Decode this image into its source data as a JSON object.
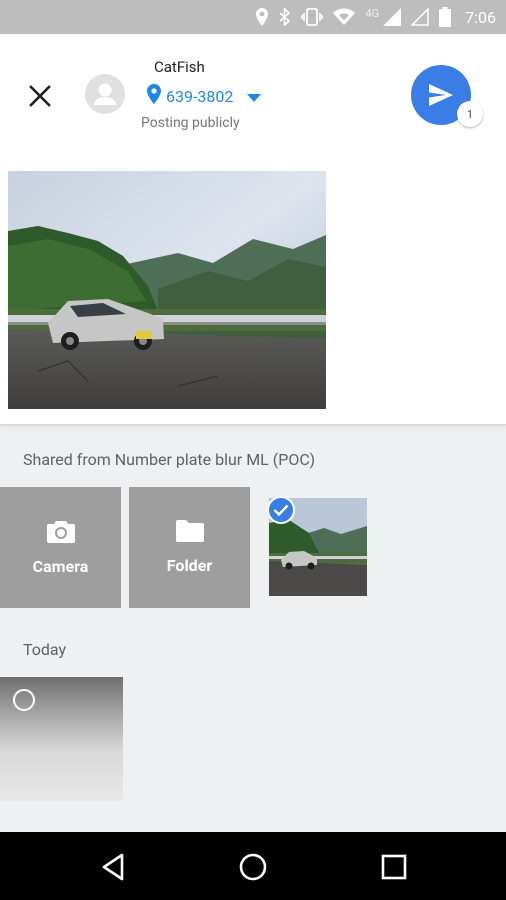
{
  "status_bar": {
    "time": "7:06",
    "network_type": "4G",
    "icons": [
      "location-icon",
      "bluetooth-icon",
      "vibrate-icon",
      "wifi-icon",
      "signal-icon",
      "signal-empty-icon",
      "battery-icon"
    ]
  },
  "header": {
    "user_name": "CatFish",
    "location": "639-3802",
    "posting_status": "Posting publicly",
    "send_badge_count": "1"
  },
  "gallery": {
    "section_shared_label": "Shared from Number plate blur ML (POC)",
    "camera_label": "Camera",
    "folder_label": "Folder",
    "section_today_label": "Today"
  },
  "colors": {
    "accent": "#3a7ee5",
    "link_blue": "#1e88e5",
    "tile_gray": "#9e9e9e",
    "background": "#eef0f1"
  }
}
